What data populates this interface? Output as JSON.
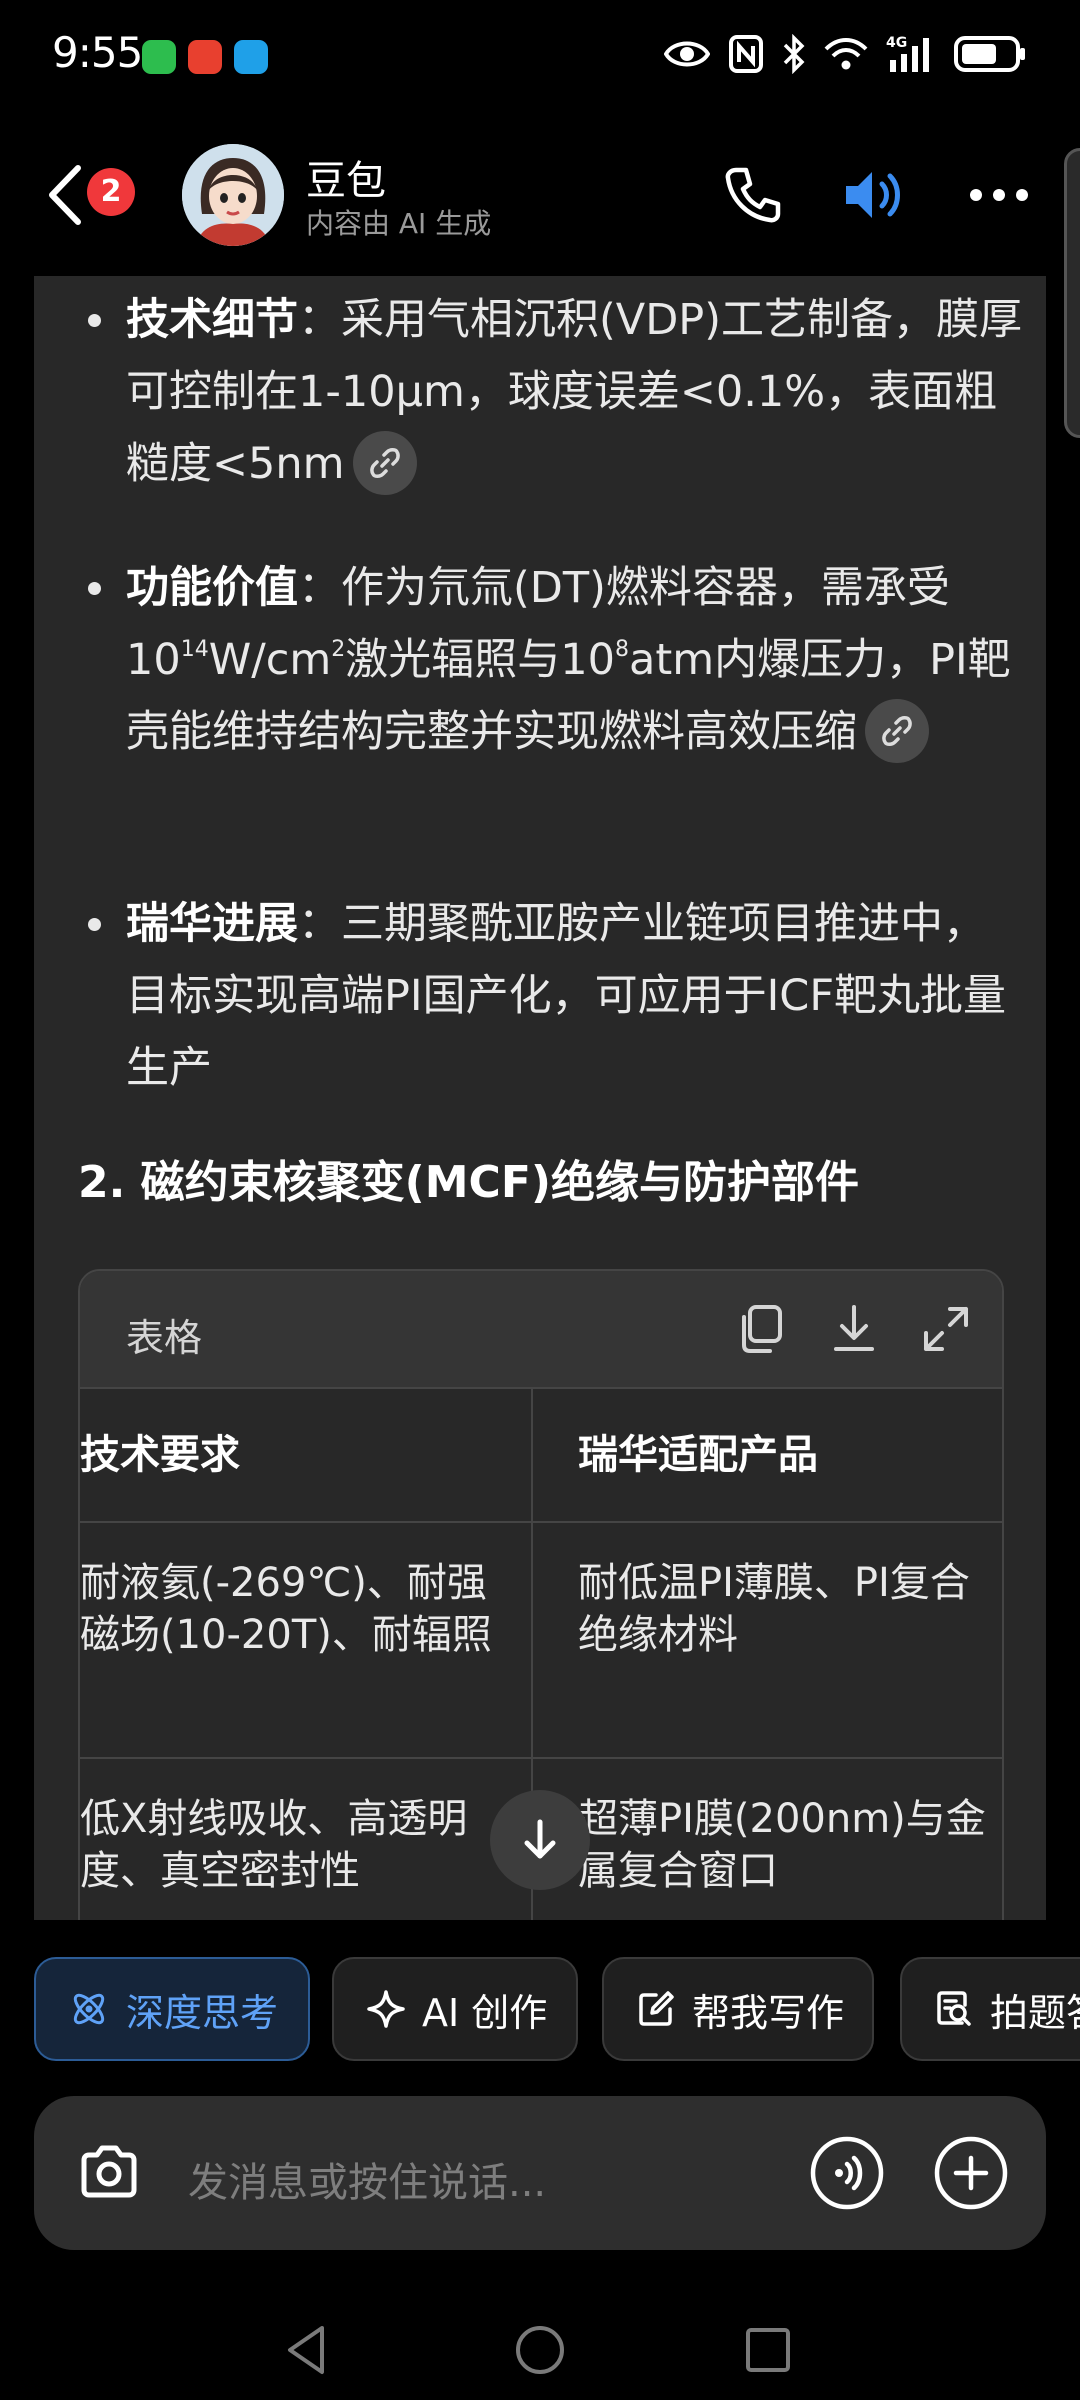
{
  "status_bar": {
    "time": "9:55",
    "network": "4G"
  },
  "header": {
    "back_badge_count": "2",
    "chat_name": "豆包",
    "chat_subtitle": "内容由 AI 生成"
  },
  "message": {
    "bullets": [
      {
        "label": "技术细节",
        "sep": "：",
        "text": "采用气相沉积(VDP)工艺制备，膜厚可控制在1-10μm，球度误差<0.1%，表面粗糙度<5nm",
        "has_link": true
      },
      {
        "label": "功能价值",
        "sep": "：",
        "text_a": "作为氘氚(DT)燃料容器，需承受10",
        "sup_a": "14",
        "text_b": "W/cm",
        "sup_b": "2",
        "text_c": "激光辐照与10",
        "sup_c": "8",
        "text_d": "atm内爆压力，PI靶壳能维持结构完整并实现燃料高效压缩",
        "has_link": true
      },
      {
        "label": "瑞华进展",
        "sep": "：",
        "text": "三期聚酰亚胺产业链项目推进中，目标实现高端PI国产化，可应用于ICF靶丸批量生产",
        "has_link": false
      }
    ],
    "section_heading": "2. 磁约束核聚变(MCF)绝缘与防护部件",
    "table": {
      "toolbar_label": "表格",
      "headers": [
        "技术要求",
        "瑞华适配产品"
      ],
      "rows": [
        [
          "耐液氦(-269℃)、耐强磁场(10-20T)、耐辐照",
          "耐低温PI薄膜、PI复合绝缘材料"
        ],
        [
          "低X射线吸收、高透明度、真空密封性",
          "超薄PI膜(200nm)与金属复合窗口"
        ]
      ]
    }
  },
  "chips": [
    {
      "label": "深度思考",
      "icon": "atom-icon",
      "active": true
    },
    {
      "label": "AI 创作",
      "icon": "sparkle-icon",
      "active": false
    },
    {
      "label": "帮我写作",
      "icon": "edit-icon",
      "active": false
    },
    {
      "label": "拍题答疑",
      "icon": "scan-question-icon",
      "active": false
    }
  ],
  "input": {
    "placeholder": "发消息或按住说话..."
  },
  "colors": {
    "background": "#000000",
    "card": "#282828",
    "accent": "#5fa2f7",
    "badge": "#f0383b"
  }
}
